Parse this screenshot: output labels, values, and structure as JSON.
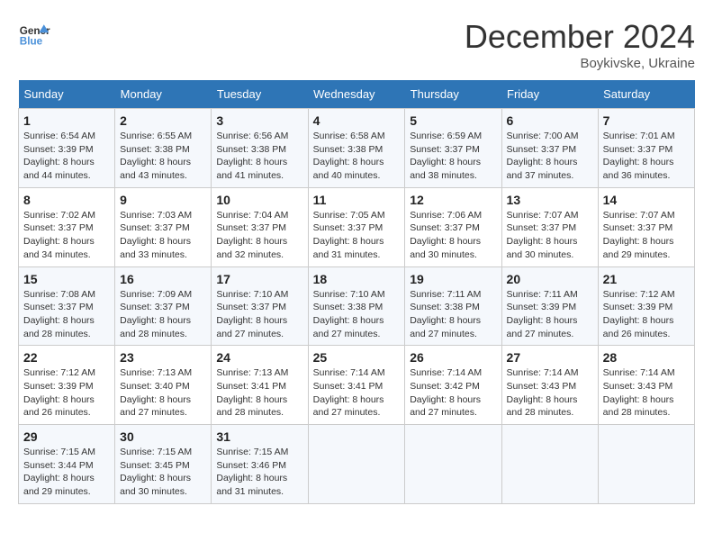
{
  "header": {
    "logo_general": "General",
    "logo_blue": "Blue",
    "month_title": "December 2024",
    "location": "Boykivske, Ukraine"
  },
  "weekdays": [
    "Sunday",
    "Monday",
    "Tuesday",
    "Wednesday",
    "Thursday",
    "Friday",
    "Saturday"
  ],
  "weeks": [
    [
      {
        "day": "1",
        "sunrise": "Sunrise: 6:54 AM",
        "sunset": "Sunset: 3:39 PM",
        "daylight": "Daylight: 8 hours and 44 minutes."
      },
      {
        "day": "2",
        "sunrise": "Sunrise: 6:55 AM",
        "sunset": "Sunset: 3:38 PM",
        "daylight": "Daylight: 8 hours and 43 minutes."
      },
      {
        "day": "3",
        "sunrise": "Sunrise: 6:56 AM",
        "sunset": "Sunset: 3:38 PM",
        "daylight": "Daylight: 8 hours and 41 minutes."
      },
      {
        "day": "4",
        "sunrise": "Sunrise: 6:58 AM",
        "sunset": "Sunset: 3:38 PM",
        "daylight": "Daylight: 8 hours and 40 minutes."
      },
      {
        "day": "5",
        "sunrise": "Sunrise: 6:59 AM",
        "sunset": "Sunset: 3:37 PM",
        "daylight": "Daylight: 8 hours and 38 minutes."
      },
      {
        "day": "6",
        "sunrise": "Sunrise: 7:00 AM",
        "sunset": "Sunset: 3:37 PM",
        "daylight": "Daylight: 8 hours and 37 minutes."
      },
      {
        "day": "7",
        "sunrise": "Sunrise: 7:01 AM",
        "sunset": "Sunset: 3:37 PM",
        "daylight": "Daylight: 8 hours and 36 minutes."
      }
    ],
    [
      {
        "day": "8",
        "sunrise": "Sunrise: 7:02 AM",
        "sunset": "Sunset: 3:37 PM",
        "daylight": "Daylight: 8 hours and 34 minutes."
      },
      {
        "day": "9",
        "sunrise": "Sunrise: 7:03 AM",
        "sunset": "Sunset: 3:37 PM",
        "daylight": "Daylight: 8 hours and 33 minutes."
      },
      {
        "day": "10",
        "sunrise": "Sunrise: 7:04 AM",
        "sunset": "Sunset: 3:37 PM",
        "daylight": "Daylight: 8 hours and 32 minutes."
      },
      {
        "day": "11",
        "sunrise": "Sunrise: 7:05 AM",
        "sunset": "Sunset: 3:37 PM",
        "daylight": "Daylight: 8 hours and 31 minutes."
      },
      {
        "day": "12",
        "sunrise": "Sunrise: 7:06 AM",
        "sunset": "Sunset: 3:37 PM",
        "daylight": "Daylight: 8 hours and 30 minutes."
      },
      {
        "day": "13",
        "sunrise": "Sunrise: 7:07 AM",
        "sunset": "Sunset: 3:37 PM",
        "daylight": "Daylight: 8 hours and 30 minutes."
      },
      {
        "day": "14",
        "sunrise": "Sunrise: 7:07 AM",
        "sunset": "Sunset: 3:37 PM",
        "daylight": "Daylight: 8 hours and 29 minutes."
      }
    ],
    [
      {
        "day": "15",
        "sunrise": "Sunrise: 7:08 AM",
        "sunset": "Sunset: 3:37 PM",
        "daylight": "Daylight: 8 hours and 28 minutes."
      },
      {
        "day": "16",
        "sunrise": "Sunrise: 7:09 AM",
        "sunset": "Sunset: 3:37 PM",
        "daylight": "Daylight: 8 hours and 28 minutes."
      },
      {
        "day": "17",
        "sunrise": "Sunrise: 7:10 AM",
        "sunset": "Sunset: 3:37 PM",
        "daylight": "Daylight: 8 hours and 27 minutes."
      },
      {
        "day": "18",
        "sunrise": "Sunrise: 7:10 AM",
        "sunset": "Sunset: 3:38 PM",
        "daylight": "Daylight: 8 hours and 27 minutes."
      },
      {
        "day": "19",
        "sunrise": "Sunrise: 7:11 AM",
        "sunset": "Sunset: 3:38 PM",
        "daylight": "Daylight: 8 hours and 27 minutes."
      },
      {
        "day": "20",
        "sunrise": "Sunrise: 7:11 AM",
        "sunset": "Sunset: 3:39 PM",
        "daylight": "Daylight: 8 hours and 27 minutes."
      },
      {
        "day": "21",
        "sunrise": "Sunrise: 7:12 AM",
        "sunset": "Sunset: 3:39 PM",
        "daylight": "Daylight: 8 hours and 26 minutes."
      }
    ],
    [
      {
        "day": "22",
        "sunrise": "Sunrise: 7:12 AM",
        "sunset": "Sunset: 3:39 PM",
        "daylight": "Daylight: 8 hours and 26 minutes."
      },
      {
        "day": "23",
        "sunrise": "Sunrise: 7:13 AM",
        "sunset": "Sunset: 3:40 PM",
        "daylight": "Daylight: 8 hours and 27 minutes."
      },
      {
        "day": "24",
        "sunrise": "Sunrise: 7:13 AM",
        "sunset": "Sunset: 3:41 PM",
        "daylight": "Daylight: 8 hours and 28 minutes."
      },
      {
        "day": "25",
        "sunrise": "Sunrise: 7:14 AM",
        "sunset": "Sunset: 3:41 PM",
        "daylight": "Daylight: 8 hours and 27 minutes."
      },
      {
        "day": "26",
        "sunrise": "Sunrise: 7:14 AM",
        "sunset": "Sunset: 3:42 PM",
        "daylight": "Daylight: 8 hours and 27 minutes."
      },
      {
        "day": "27",
        "sunrise": "Sunrise: 7:14 AM",
        "sunset": "Sunset: 3:43 PM",
        "daylight": "Daylight: 8 hours and 28 minutes."
      },
      {
        "day": "28",
        "sunrise": "Sunrise: 7:14 AM",
        "sunset": "Sunset: 3:43 PM",
        "daylight": "Daylight: 8 hours and 28 minutes."
      }
    ],
    [
      {
        "day": "29",
        "sunrise": "Sunrise: 7:15 AM",
        "sunset": "Sunset: 3:44 PM",
        "daylight": "Daylight: 8 hours and 29 minutes."
      },
      {
        "day": "30",
        "sunrise": "Sunrise: 7:15 AM",
        "sunset": "Sunset: 3:45 PM",
        "daylight": "Daylight: 8 hours and 30 minutes."
      },
      {
        "day": "31",
        "sunrise": "Sunrise: 7:15 AM",
        "sunset": "Sunset: 3:46 PM",
        "daylight": "Daylight: 8 hours and 31 minutes."
      },
      null,
      null,
      null,
      null
    ]
  ]
}
